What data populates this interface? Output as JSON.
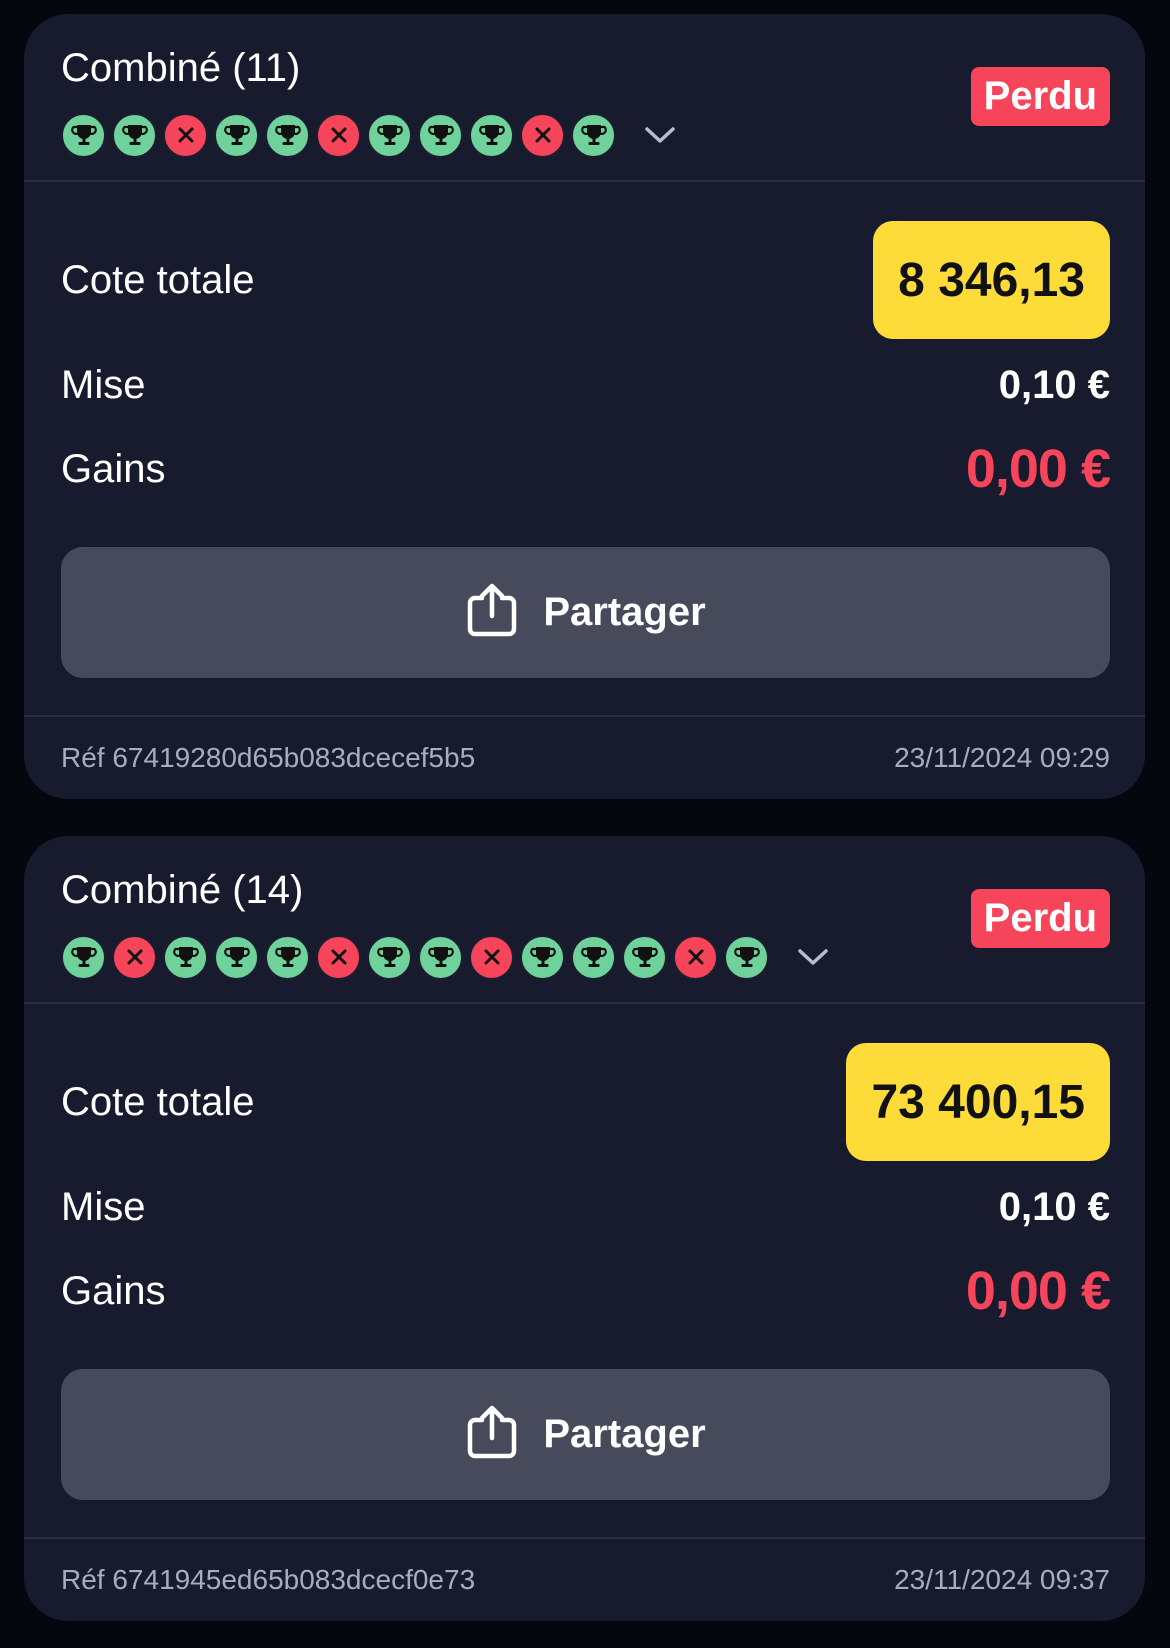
{
  "colors": {
    "background": "#05070f",
    "card": "#171b2d",
    "won": "#6fd29b",
    "lost": "#f6455a",
    "odds_highlight": "#fddc3a",
    "share_button": "#474a5a"
  },
  "bets": [
    {
      "title": "Combiné (11)",
      "status": "Perdu",
      "legs": [
        "won",
        "won",
        "lost",
        "won",
        "won",
        "lost",
        "won",
        "won",
        "won",
        "lost",
        "won"
      ],
      "odds_label": "Cote totale",
      "odds_value": "8 346,13",
      "stake_label": "Mise",
      "stake_value": "0,10 €",
      "winnings_label": "Gains",
      "winnings_value": "0,00 €",
      "share_label": "Partager",
      "reference": "Réf 67419280d65b083dcecef5b5",
      "datetime": "23/11/2024 09:29"
    },
    {
      "title": "Combiné (14)",
      "status": "Perdu",
      "legs": [
        "won",
        "lost",
        "won",
        "won",
        "won",
        "lost",
        "won",
        "won",
        "lost",
        "won",
        "won",
        "won",
        "lost",
        "won"
      ],
      "odds_label": "Cote totale",
      "odds_value": "73 400,15",
      "stake_label": "Mise",
      "stake_value": "0,10 €",
      "winnings_label": "Gains",
      "winnings_value": "0,00 €",
      "share_label": "Partager",
      "reference": "Réf 6741945ed65b083dcecf0e73",
      "datetime": "23/11/2024 09:37"
    }
  ]
}
